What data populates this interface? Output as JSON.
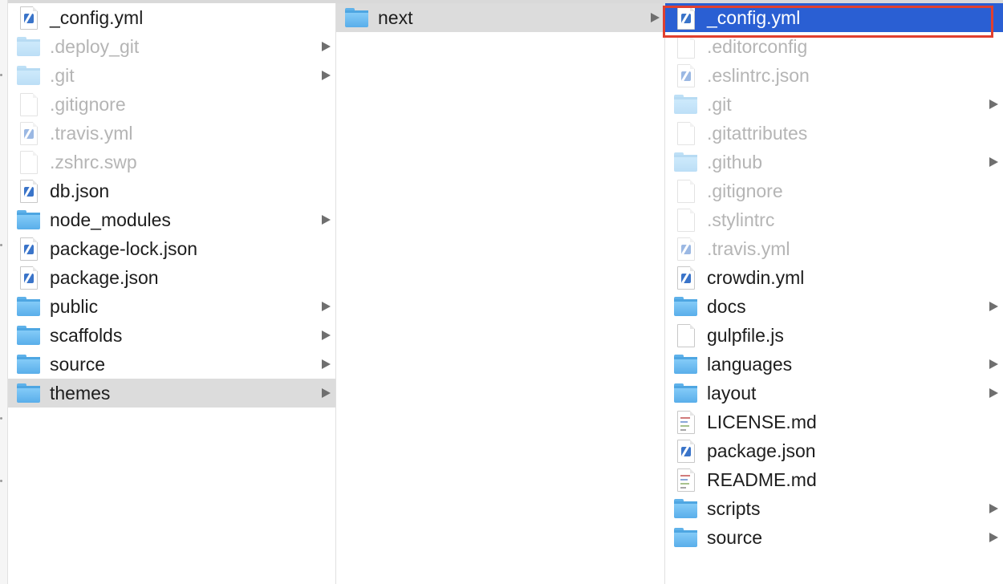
{
  "colors": {
    "selection_blue": "#2a5fd3",
    "selection_gray": "#dcdcdc",
    "highlight_red": "#e0402f"
  },
  "columns": [
    {
      "items": [
        {
          "label": "_config.yml",
          "icon": "yml-file-icon",
          "dim": false,
          "chevron": false,
          "selected": ""
        },
        {
          "label": ".deploy_git",
          "icon": "folder-icon",
          "dim": true,
          "chevron": true,
          "selected": ""
        },
        {
          "label": ".git",
          "icon": "folder-icon",
          "dim": true,
          "chevron": true,
          "selected": ""
        },
        {
          "label": ".gitignore",
          "icon": "document-icon",
          "dim": true,
          "chevron": false,
          "selected": ""
        },
        {
          "label": ".travis.yml",
          "icon": "yml-file-icon",
          "dim": true,
          "chevron": false,
          "selected": ""
        },
        {
          "label": ".zshrc.swp",
          "icon": "document-icon",
          "dim": true,
          "chevron": false,
          "selected": ""
        },
        {
          "label": "db.json",
          "icon": "yml-file-icon",
          "dim": false,
          "chevron": false,
          "selected": ""
        },
        {
          "label": "node_modules",
          "icon": "folder-icon",
          "dim": false,
          "chevron": true,
          "selected": ""
        },
        {
          "label": "package-lock.json",
          "icon": "yml-file-icon",
          "dim": false,
          "chevron": false,
          "selected": ""
        },
        {
          "label": "package.json",
          "icon": "yml-file-icon",
          "dim": false,
          "chevron": false,
          "selected": ""
        },
        {
          "label": "public",
          "icon": "folder-icon",
          "dim": false,
          "chevron": true,
          "selected": ""
        },
        {
          "label": "scaffolds",
          "icon": "folder-icon",
          "dim": false,
          "chevron": true,
          "selected": ""
        },
        {
          "label": "source",
          "icon": "folder-icon",
          "dim": false,
          "chevron": true,
          "selected": ""
        },
        {
          "label": "themes",
          "icon": "folder-icon",
          "dim": false,
          "chevron": true,
          "selected": "gray"
        }
      ]
    },
    {
      "items": [
        {
          "label": "next",
          "icon": "folder-icon",
          "dim": false,
          "chevron": true,
          "selected": "gray"
        }
      ]
    },
    {
      "items": [
        {
          "label": "_config.yml",
          "icon": "yml-file-icon",
          "dim": false,
          "chevron": false,
          "selected": "blue"
        },
        {
          "label": ".editorconfig",
          "icon": "document-icon",
          "dim": true,
          "chevron": false,
          "selected": ""
        },
        {
          "label": ".eslintrc.json",
          "icon": "yml-file-icon",
          "dim": true,
          "chevron": false,
          "selected": ""
        },
        {
          "label": ".git",
          "icon": "folder-icon",
          "dim": true,
          "chevron": true,
          "selected": ""
        },
        {
          "label": ".gitattributes",
          "icon": "document-icon",
          "dim": true,
          "chevron": false,
          "selected": ""
        },
        {
          "label": ".github",
          "icon": "folder-icon",
          "dim": true,
          "chevron": true,
          "selected": ""
        },
        {
          "label": ".gitignore",
          "icon": "document-icon",
          "dim": true,
          "chevron": false,
          "selected": ""
        },
        {
          "label": ".stylintrc",
          "icon": "document-icon",
          "dim": true,
          "chevron": false,
          "selected": ""
        },
        {
          "label": ".travis.yml",
          "icon": "yml-file-icon",
          "dim": true,
          "chevron": false,
          "selected": ""
        },
        {
          "label": "crowdin.yml",
          "icon": "yml-file-icon",
          "dim": false,
          "chevron": false,
          "selected": ""
        },
        {
          "label": "docs",
          "icon": "folder-icon",
          "dim": false,
          "chevron": true,
          "selected": ""
        },
        {
          "label": "gulpfile.js",
          "icon": "document-icon",
          "dim": false,
          "chevron": false,
          "selected": ""
        },
        {
          "label": "languages",
          "icon": "folder-icon",
          "dim": false,
          "chevron": true,
          "selected": ""
        },
        {
          "label": "layout",
          "icon": "folder-icon",
          "dim": false,
          "chevron": true,
          "selected": ""
        },
        {
          "label": "LICENSE.md",
          "icon": "markdown-file-icon",
          "dim": false,
          "chevron": false,
          "selected": ""
        },
        {
          "label": "package.json",
          "icon": "yml-file-icon",
          "dim": false,
          "chevron": false,
          "selected": ""
        },
        {
          "label": "README.md",
          "icon": "markdown-file-icon",
          "dim": false,
          "chevron": false,
          "selected": ""
        },
        {
          "label": "scripts",
          "icon": "folder-icon",
          "dim": false,
          "chevron": true,
          "selected": ""
        },
        {
          "label": "source",
          "icon": "folder-icon",
          "dim": false,
          "chevron": true,
          "selected": ""
        }
      ]
    }
  ]
}
